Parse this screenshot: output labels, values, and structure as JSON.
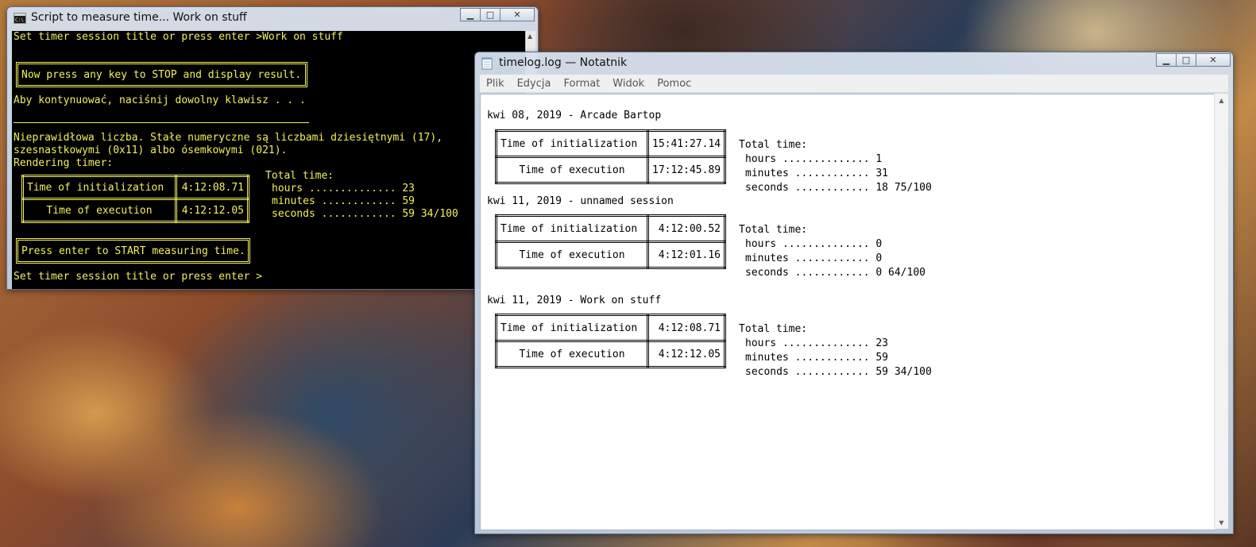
{
  "console": {
    "title": "Script to measure time... Work on stuff",
    "lines": {
      "prompt1": "Set timer session title or press enter >Work on stuff",
      "stop_box": "Now press any key to STOP and display result.",
      "continue": "Aby kontynuować, naciśnij dowolny klawisz . . .",
      "error1": "Nieprawidłowa liczba. Stałe numeryczne są liczbami dziesiętnymi (17),",
      "error2": "szesnastkowymi (0x11) albo ósemkowymi (021).",
      "rendering": "Rendering timer:",
      "start_box": "Press enter to START measuring time.",
      "prompt2": "Set timer session title or press enter >"
    },
    "timer": {
      "init_label": "Time of initialization",
      "init_value": "4:12:08.71",
      "exec_label": "Time of execution",
      "exec_value": "4:12:12.05",
      "total_label": "Total time:",
      "hours": "hours .............. 23",
      "minutes": "minutes ............ 59",
      "seconds": "seconds ............ 59 34/100"
    }
  },
  "notepad": {
    "title": "timelog.log — Notatnik",
    "menu": [
      "Plik",
      "Edycja",
      "Format",
      "Widok",
      "Pomoc"
    ],
    "entries": [
      {
        "header": "kwi 08, 2019 - Arcade Bartop",
        "init_label": "Time of initialization",
        "init_value": "15:41:27.14",
        "exec_label": "Time of execution",
        "exec_value": "17:12:45.89",
        "total_label": "Total time:",
        "hours": "hours .............. 1",
        "minutes": "minutes ............ 31",
        "seconds": "seconds ............ 18 75/100"
      },
      {
        "header": "kwi 11, 2019 - unnamed session",
        "init_label": "Time of initialization",
        "init_value": "4:12:00.52",
        "exec_label": "Time of execution",
        "exec_value": "4:12:01.16",
        "total_label": "Total time:",
        "hours": "hours .............. 0",
        "minutes": "minutes ............ 0",
        "seconds": "seconds ............ 0 64/100"
      },
      {
        "header": "kwi 11, 2019 - Work on stuff",
        "init_label": "Time of initialization",
        "init_value": "4:12:08.71",
        "exec_label": "Time of execution",
        "exec_value": "4:12:12.05",
        "total_label": "Total time:",
        "hours": "hours .............. 23",
        "minutes": "minutes ............ 59",
        "seconds": "seconds ............ 59 34/100"
      }
    ]
  },
  "caption_buttons": {
    "minimize": "▁",
    "maximize": "□",
    "close": "✕"
  }
}
